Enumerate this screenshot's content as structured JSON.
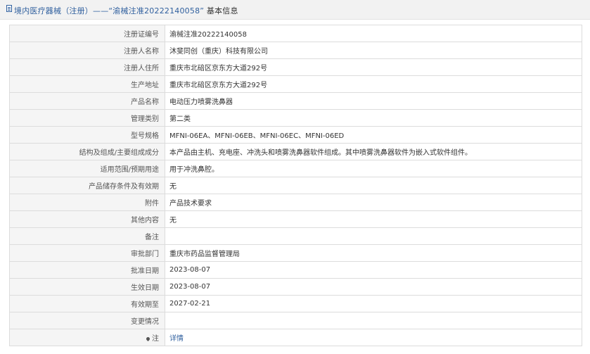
{
  "header": {
    "title": "境内医疗器械（注册）——“渝械注准20222140058”",
    "title_suffix": "基本信息",
    "icon": "document-icon"
  },
  "rows": [
    {
      "label": "注册证编号",
      "value": "渝械注准20222140058"
    },
    {
      "label": "注册人名称",
      "value": "沐斐同创（重庆）科技有限公司"
    },
    {
      "label": "注册人住所",
      "value": "重庆市北碚区京东方大道292号"
    },
    {
      "label": "生产地址",
      "value": "重庆市北碚区京东方大道292号"
    },
    {
      "label": "产品名称",
      "value": "电动压力喷雾洗鼻器"
    },
    {
      "label": "管理类别",
      "value": "第二类"
    },
    {
      "label": "型号规格",
      "value": "MFNI-06EA、MFNI-06EB、MFNI-06EC、MFNI-06ED"
    },
    {
      "label": "结构及组成/主要组成成分",
      "value": "本产品由主机、充电座、冲洗头和喷雾洗鼻器软件组成。其中喷雾洗鼻器软件为嵌入式软件组件。"
    },
    {
      "label": "适用范围/预期用途",
      "value": "用于冲洗鼻腔。"
    },
    {
      "label": "产品储存条件及有效期",
      "value": "无"
    },
    {
      "label": "附件",
      "value": "产品技术要求"
    },
    {
      "label": "其他内容",
      "value": "无"
    },
    {
      "label": "备注",
      "value": ""
    },
    {
      "label": "审批部门",
      "value": "重庆市药品监督管理局"
    },
    {
      "label": "批准日期",
      "value": "2023-08-07"
    },
    {
      "label": "生效日期",
      "value": "2023-08-07"
    },
    {
      "label": "有效期至",
      "value": "2027-02-21"
    },
    {
      "label": "变更情况",
      "value": ""
    }
  ],
  "note_row": {
    "icon": "pin-icon",
    "label": "注",
    "link_text": "详情"
  },
  "colors": {
    "accent": "#2f5f9e",
    "label_bg": "#f5f5f5",
    "border": "#dcdcdc",
    "header_bg": "#f2f2f2"
  }
}
